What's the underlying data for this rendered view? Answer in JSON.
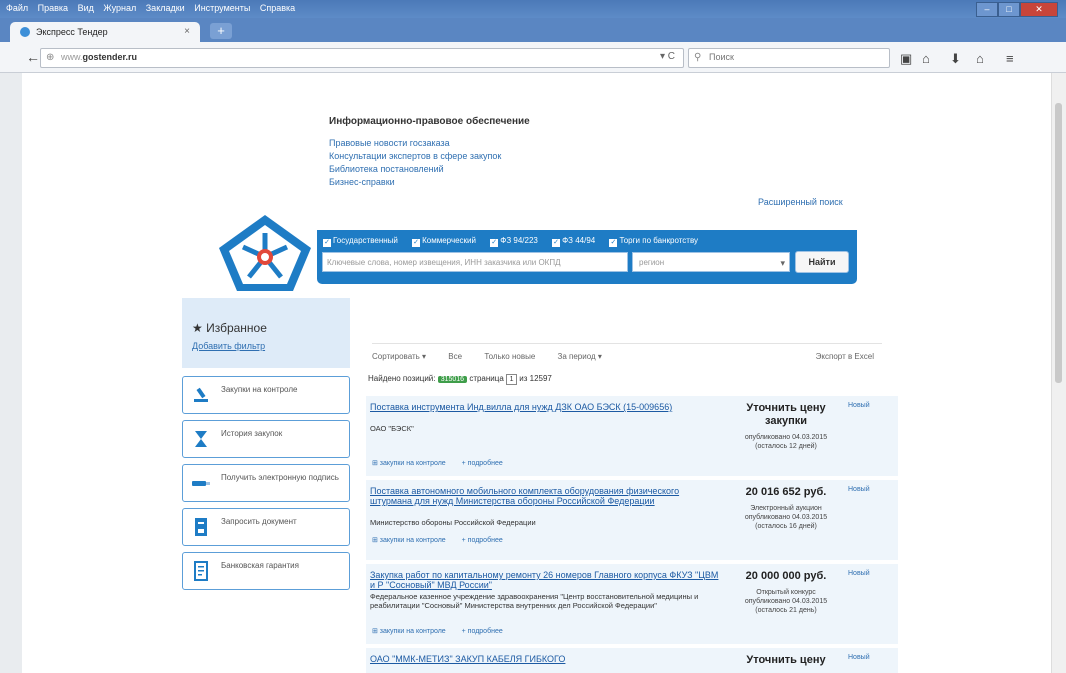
{
  "browser": {
    "menu": [
      "Файл",
      "Правка",
      "Вид",
      "Журнал",
      "Закладки",
      "Инструменты",
      "Справка"
    ],
    "tab_title": "Экспресс Тендер",
    "tab_close": "×",
    "new_tab": "+",
    "url_prefix": "www.",
    "url_domain": "gostender.ru",
    "search_placeholder": "Поиск"
  },
  "info": {
    "title": "Информационно-правовое обеспечение",
    "links": [
      "Правовые новости госзаказа",
      "Консультации экспертов в сфере закупок",
      "Библиотека постановлений",
      "Бизнес-справки"
    ]
  },
  "search": {
    "advanced_link": "Расширенный поиск",
    "checkboxes": [
      "Государственный",
      "Коммерческий",
      "ФЗ 94/223",
      "ФЗ 44/94",
      "Торги по банкротству"
    ],
    "keyword_placeholder": "Ключевые слова, номер извещения, ИНН заказчика или ОКПД",
    "region_placeholder": "регион",
    "find_button": "Найти"
  },
  "sidebar": {
    "favorites_title": "★ Избранное",
    "favorites_link": "Добавить фильтр",
    "items": [
      {
        "label": "Закупки на контроле",
        "icon": "hammer-icon"
      },
      {
        "label": "История закупок",
        "icon": "hourglass-icon"
      },
      {
        "label": "Получить электронную подпись",
        "icon": "usb-key-icon"
      },
      {
        "label": "Запросить документ",
        "icon": "document-request-icon"
      },
      {
        "label": "Банковская гарантия",
        "icon": "guarantee-document-icon"
      }
    ]
  },
  "results": {
    "toolbar": [
      "Сортировать ▾",
      "Все",
      "Только новые",
      "За период ▾"
    ],
    "export": "Экспорт в Excel",
    "found_prefix": "Найдено позиций:",
    "found_count": "315016",
    "page_label": "страница",
    "page_num": "1",
    "page_total": "из 12597",
    "action_control": "⊞ закупки на контроле",
    "action_more": "+ подробнее",
    "items": [
      {
        "title": "Поставка инструмента Инд.вилла для нужд ДЗК ОАО БЭСК (15-009656)",
        "org": "ОАО \"БЭСК\"",
        "price": "Уточнить цену закупки",
        "type": "",
        "published": "опубликовано 04.03.2015",
        "remaining": "(осталось 12 дней)",
        "status": "Новый"
      },
      {
        "title": "Поставка автономного мобильного комплекта оборудования физического штурмана для нужд Министерства обороны Российской Федерации",
        "org": "Министерство обороны Российской Федерации",
        "price": "20 016 652 руб.",
        "type": "Электронный аукцион",
        "published": "опубликовано 04.03.2015",
        "remaining": "(осталось 16 дней)",
        "status": "Новый"
      },
      {
        "title": "Закупка работ по капитальному ремонту 26 номеров Главного корпуса ФКУЗ \"ЦВМ и Р \"Сосновый\" МВД России\"",
        "org": "Федеральное казенное учреждение здравоохранения \"Центр восстановительной медицины и реабилитации \"Сосновый\" Министерства внутренних дел Российской Федерации\"",
        "price": "20 000 000 руб.",
        "type": "Открытый конкурс",
        "published": "опубликовано 04.03.2015",
        "remaining": "(осталось 21 день)",
        "status": "Новый"
      },
      {
        "title": "ОАО \"ММК-МЕТИЗ\" ЗАКУП КАБЕЛЯ ГИБКОГО",
        "org": "",
        "price": "Уточнить цену",
        "type": "",
        "published": "",
        "remaining": "",
        "status": "Новый"
      }
    ]
  },
  "colors": {
    "accent": "#1e7cc5",
    "link": "#2f6fb1",
    "badge": "#3f9e4a",
    "card_bg": "#eef5fb"
  }
}
